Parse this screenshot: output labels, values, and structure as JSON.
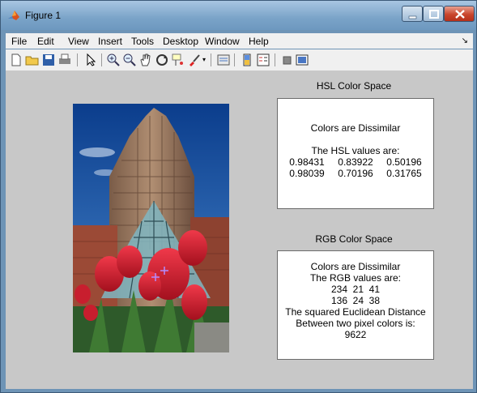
{
  "window": {
    "title": "Figure 1"
  },
  "menu": {
    "items": [
      "File",
      "Edit",
      "View",
      "Insert",
      "Tools",
      "Desktop",
      "Window",
      "Help"
    ]
  },
  "toolbar": {
    "icons": [
      "new-figure-icon",
      "open-file-icon",
      "save-icon",
      "print-icon",
      "pointer-icon",
      "zoom-in-icon",
      "zoom-out-icon",
      "pan-hand-icon",
      "rotate-3d-icon",
      "data-cursor-icon",
      "brush-icon",
      "link-plot-icon",
      "colorbar-icon",
      "legend-icon",
      "hide-plot-tools-icon",
      "show-plot-tools-icon"
    ]
  },
  "hsl": {
    "title": "HSL Color Space",
    "result": "Colors are Dissimilar",
    "header": "The HSL values are:",
    "rows": [
      [
        "0.98431",
        "0.83922",
        "0.50196"
      ],
      [
        "0.98039",
        "0.70196",
        "0.31765"
      ]
    ]
  },
  "rgb": {
    "title": "RGB Color Space",
    "result": "Colors are Dissimilar",
    "header": "The RGB values are:",
    "row1": "234  21  41",
    "row2": "136  24  38",
    "dist_line1": "The squared Euclidean Distance",
    "dist_line2": "Between two pixel colors is:",
    "distance": "9622"
  },
  "colors": {
    "title_bar": "#7aa3c8",
    "figure_bg": "#c8c8c8",
    "close_button": "#c9452c",
    "marker": "#b28cff"
  }
}
